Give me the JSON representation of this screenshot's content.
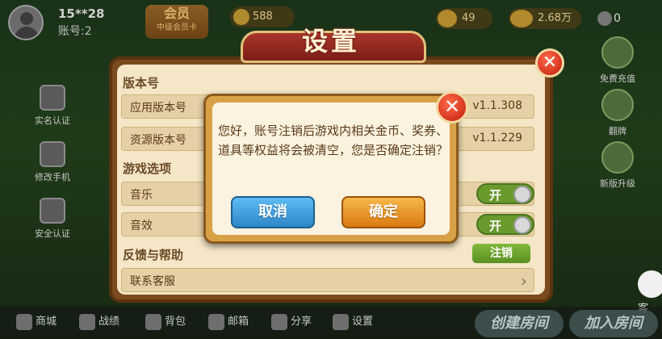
{
  "topbar": {
    "username": "15**28",
    "account": "账号:2",
    "vip_title": "会员",
    "vip_sub": "中级会员卡",
    "coins": "588",
    "resource1": "49",
    "resource2": "2.68万",
    "resource3": "0"
  },
  "side_left": [
    {
      "label": "实名认证",
      "icon": "id-card-icon"
    },
    {
      "label": "修改手机",
      "icon": "phone-icon"
    },
    {
      "label": "安全认证",
      "icon": "shield-icon"
    }
  ],
  "side_right": [
    {
      "label": "免费充值",
      "icon": "free-recharge-icon"
    },
    {
      "label": "翻牌",
      "icon": "flip-icon"
    },
    {
      "label": "新版升级",
      "icon": "upgrade-icon"
    }
  ],
  "service_label": "客",
  "bottombar": {
    "items": [
      "商城",
      "战绩",
      "背包",
      "邮箱",
      "分享",
      "设置"
    ],
    "create_room": "创建房间",
    "join_room": "加入房间"
  },
  "settings": {
    "title": "设置",
    "version_section": "版本号",
    "app_version_label": "应用版本号",
    "app_version": "v1.1.308",
    "res_version_label": "资源版本号",
    "res_version": "v1.1.229",
    "game_options": "游戏选项",
    "music_label": "音乐",
    "music_toggle": "开",
    "sound_label": "音效",
    "sound_toggle": "开",
    "feedback_section": "反馈与帮助",
    "logout_button": "注销",
    "contact_label": "联系客服"
  },
  "dialog": {
    "message": "您好，账号注销后游戏内相关金币、奖券、道具等权益将会被清空，您是否确定注销？",
    "cancel": "取消",
    "confirm": "确定"
  },
  "colors": {
    "panel_brown": "#7b4a1e",
    "panel_cream": "#f4e6c6",
    "toggle_green": "#6a9a2e",
    "cancel_blue": "#2f86c8",
    "confirm_orange": "#d97a12",
    "close_red": "#c31d0a"
  }
}
